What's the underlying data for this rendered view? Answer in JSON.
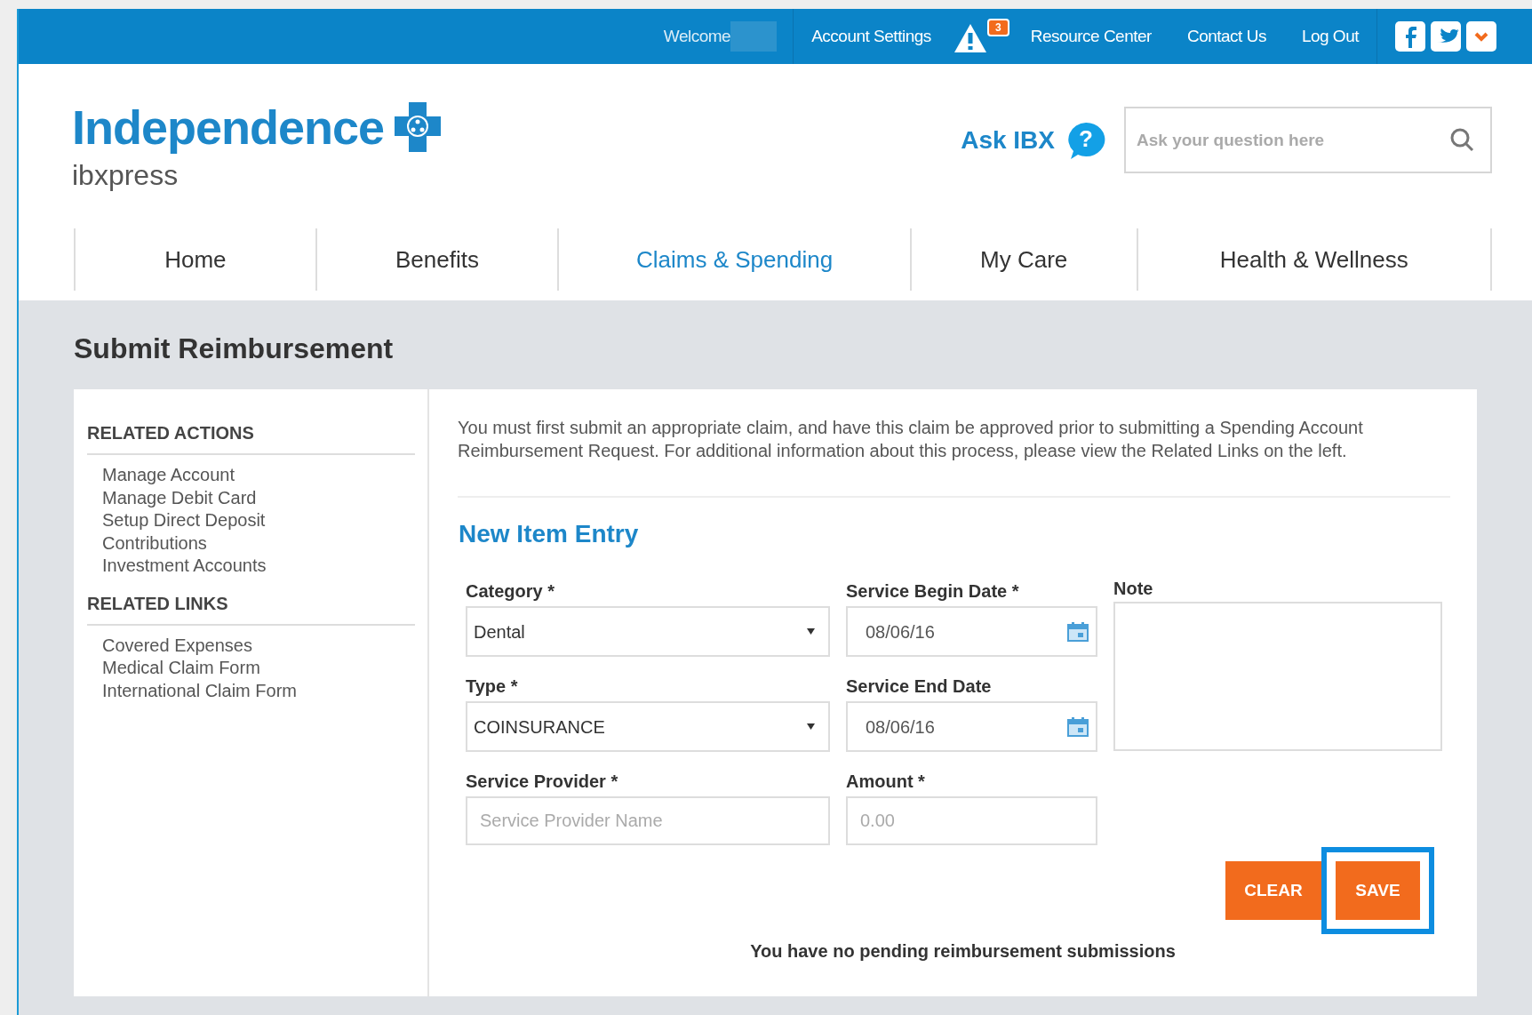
{
  "top_bar": {
    "welcome": "Welcome",
    "links": [
      {
        "label": "Account Settings"
      },
      {
        "label": "Resource Center"
      },
      {
        "label": "Contact Us"
      },
      {
        "label": "Log Out"
      }
    ],
    "alert_count": "3"
  },
  "header": {
    "logo": "Independence",
    "sub_logo": "ibxpress",
    "ask_label": "Ask IBX",
    "help_glyph": "?",
    "search": {
      "placeholder": "Ask your question here"
    }
  },
  "nav": [
    {
      "label": "Home",
      "selected": false
    },
    {
      "label": "Benefits",
      "selected": false
    },
    {
      "label": "Claims & Spending",
      "selected": true
    },
    {
      "label": "My Care",
      "selected": false
    },
    {
      "label": "Health & Wellness",
      "selected": false
    }
  ],
  "page_title": "Submit Reimbursement",
  "sidebar": [
    {
      "heading": "RELATED ACTIONS",
      "items": [
        "Manage Account",
        "Manage Debit Card",
        "Setup Direct Deposit",
        "Contributions",
        "Investment Accounts"
      ]
    },
    {
      "heading": "RELATED LINKS",
      "items": [
        "Covered Expenses",
        "Medical Claim Form",
        "International Claim Form"
      ]
    }
  ],
  "intro": "You must first submit an appropriate claim, and have this claim be approved prior to submitting a Spending Account Reimbursement Request. For additional information about this process, please view the Related Links on the left.",
  "section_title": "New Item Entry",
  "form": {
    "category": {
      "label": "Category *",
      "value": "Dental"
    },
    "service_begin_date": {
      "label": "Service Begin Date *",
      "value": "08/06/16"
    },
    "note": {
      "label": "Note"
    },
    "type": {
      "label": "Type *",
      "value": "COINSURANCE"
    },
    "service_end_date": {
      "label": "Service End Date",
      "value": "08/06/16"
    },
    "service_provider": {
      "label": "Service Provider *",
      "placeholder": "Service Provider Name"
    },
    "amount": {
      "label": "Amount *",
      "placeholder": "0.00"
    }
  },
  "buttons": [
    {
      "label": "CLEAR",
      "highlighted": false
    },
    {
      "label": "SAVE",
      "highlighted": true
    }
  ],
  "message": "You have no pending reimbursement submissions"
}
